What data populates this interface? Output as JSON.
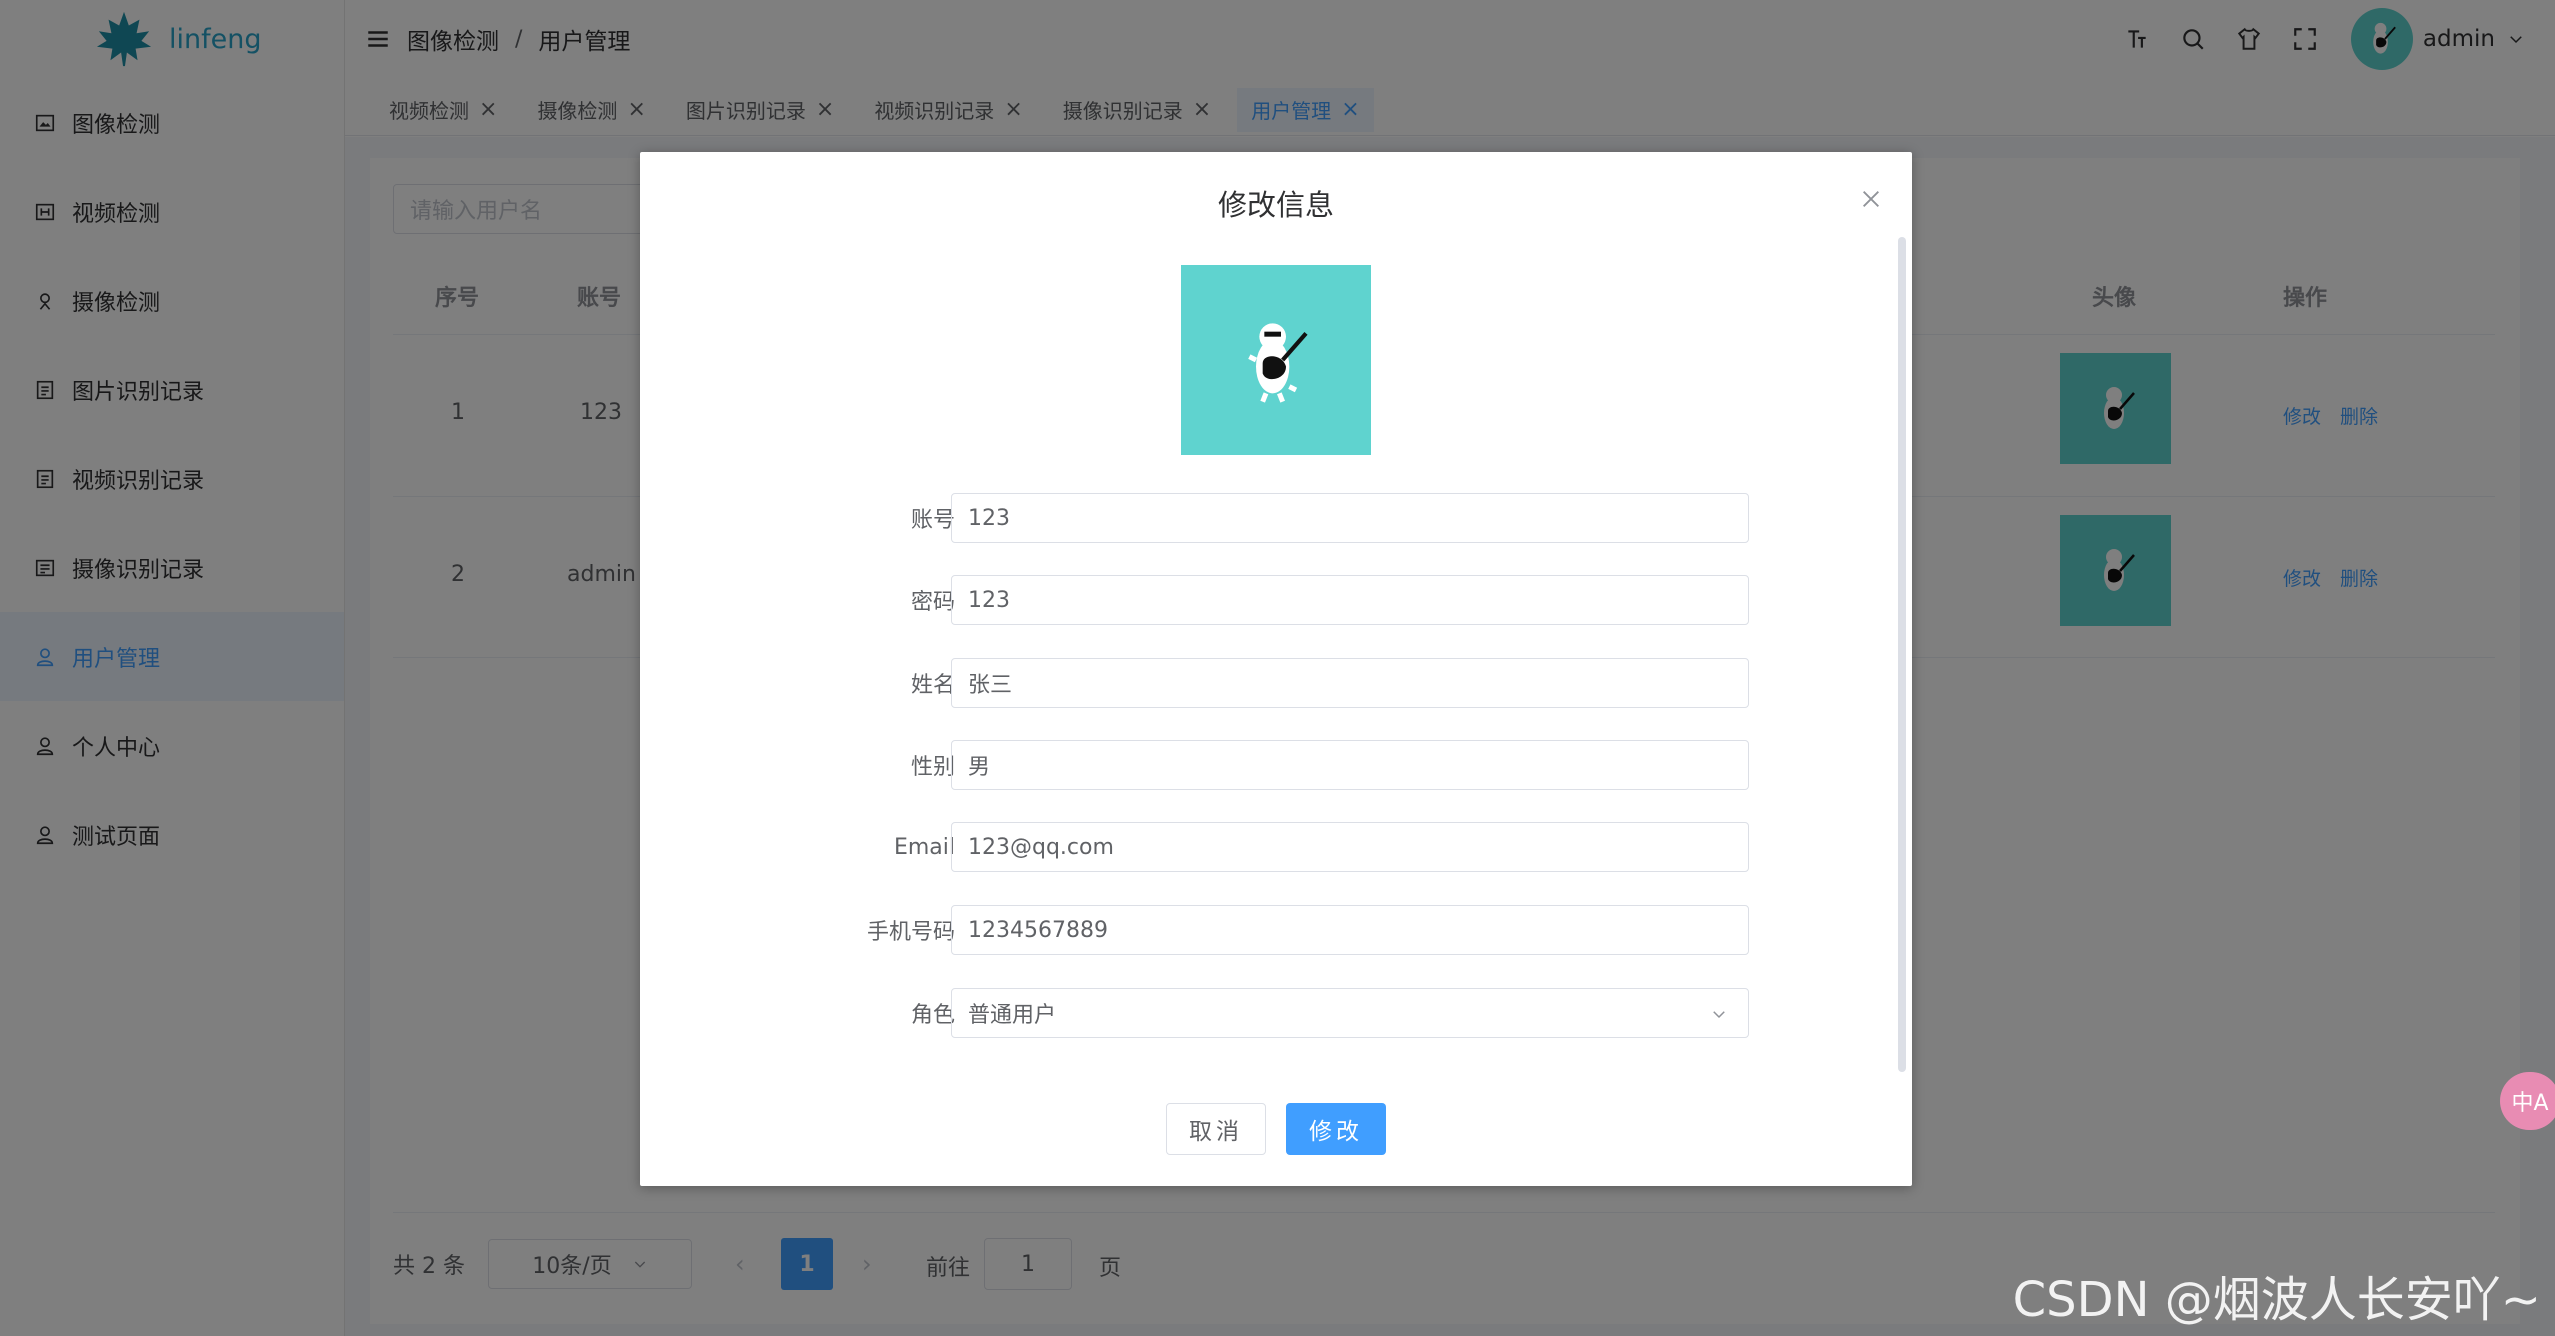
{
  "app": {
    "logo_text": "linfeng"
  },
  "sidebar": {
    "items": [
      {
        "label": "图像检测",
        "icon": "image-icon"
      },
      {
        "label": "视频检测",
        "icon": "video-icon"
      },
      {
        "label": "摄像检测",
        "icon": "camera-icon"
      },
      {
        "label": "图片识别记录",
        "icon": "document-icon"
      },
      {
        "label": "视频识别记录",
        "icon": "document-icon"
      },
      {
        "label": "摄像识别记录",
        "icon": "document-icon"
      },
      {
        "label": "用户管理",
        "icon": "user-icon",
        "active": true
      },
      {
        "label": "个人中心",
        "icon": "user-icon"
      },
      {
        "label": "测试页面",
        "icon": "user-icon"
      }
    ]
  },
  "header": {
    "breadcrumb": [
      "图像检测",
      "用户管理"
    ],
    "breadcrumb_sep": "/",
    "user_name": "admin"
  },
  "tabs": [
    {
      "label": "视频检测"
    },
    {
      "label": "摄像检测"
    },
    {
      "label": "图片识别记录"
    },
    {
      "label": "视频识别记录"
    },
    {
      "label": "摄像识别记录"
    },
    {
      "label": "用户管理",
      "active": true
    }
  ],
  "table": {
    "search_placeholder": "请输入用户名",
    "headers": {
      "index": "序号",
      "account": "账号",
      "avatar": "头像",
      "actions": "操作"
    },
    "rows": [
      {
        "index": "1",
        "account": "123",
        "edit": "修改",
        "delete": "删除"
      },
      {
        "index": "2",
        "account": "admin",
        "edit": "修改",
        "delete": "删除"
      }
    ]
  },
  "pagination": {
    "total": "共 2 条",
    "page_size": "10条/页",
    "current_page": "1",
    "goto_label": "前往",
    "goto_value": "1",
    "goto_unit": "页"
  },
  "dialog": {
    "title": "修改信息",
    "fields": [
      {
        "label": "账号",
        "value": "123"
      },
      {
        "label": "密码",
        "value": "123"
      },
      {
        "label": "姓名",
        "value": "张三"
      },
      {
        "label": "性别",
        "value": "男"
      },
      {
        "label": "Email",
        "value": "123@qq.com"
      },
      {
        "label": "手机号码",
        "value": "1234567889"
      },
      {
        "label": "角色",
        "value": "普通用户"
      }
    ],
    "cancel_label": "取消",
    "submit_label": "修改"
  },
  "misc": {
    "translate_label": "中A",
    "watermark": "CSDN @烟波人长安吖~"
  },
  "colors": {
    "primary": "#409eff",
    "avatar_bg": "#5fd3cf",
    "overlay": "rgba(0,0,0,0.5)"
  }
}
